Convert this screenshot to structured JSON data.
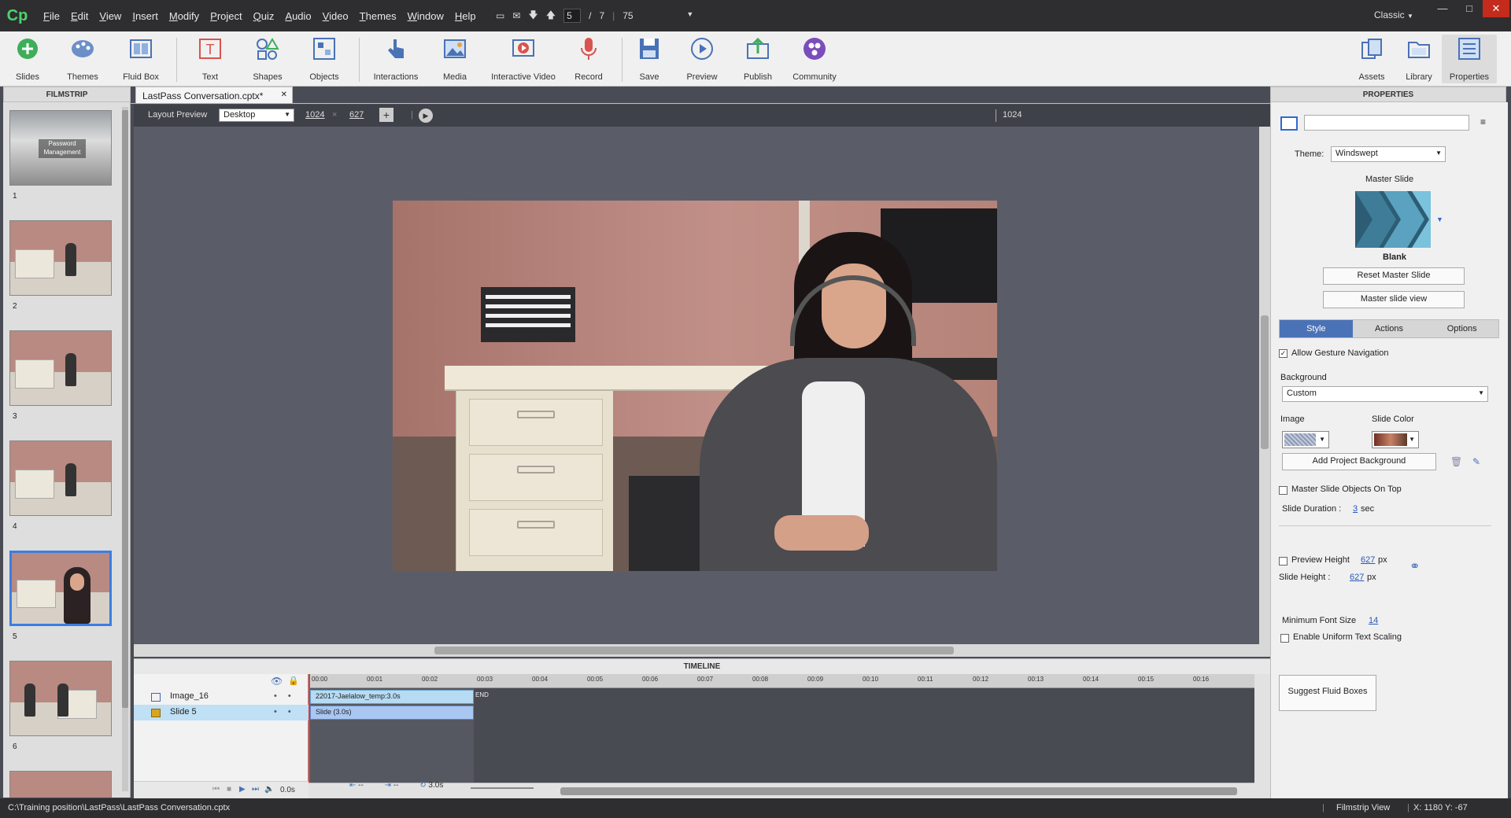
{
  "app": {
    "logo": "Cp",
    "mode": "Classic"
  },
  "menu": [
    "File",
    "Edit",
    "View",
    "Insert",
    "Modify",
    "Project",
    "Quiz",
    "Audio",
    "Video",
    "Themes",
    "Window",
    "Help"
  ],
  "navigation": {
    "current_slide": "5",
    "separator": "/",
    "total_slides": "7",
    "zoom": "75"
  },
  "toolbar": {
    "slides": "Slides",
    "themes": "Themes",
    "fluid_box": "Fluid Box",
    "text": "Text",
    "shapes": "Shapes",
    "objects": "Objects",
    "interactions": "Interactions",
    "media": "Media",
    "interactive_video": "Interactive Video",
    "record": "Record",
    "save": "Save",
    "preview": "Preview",
    "publish": "Publish",
    "community": "Community",
    "assets": "Assets",
    "library": "Library",
    "properties": "Properties"
  },
  "filmstrip": {
    "title": "FILMSTRIP",
    "thumb1_text": "Password Management",
    "numbers": [
      "1",
      "2",
      "3",
      "4",
      "5",
      "6"
    ]
  },
  "document": {
    "tab": "LastPass Conversation.cptx*"
  },
  "layout_preview": {
    "label": "Layout Preview",
    "device": "Desktop",
    "width": "1024",
    "height": "627",
    "ruler_value": "1024"
  },
  "timeline": {
    "title": "TIMELINE",
    "rows": [
      {
        "name": "Image_16"
      },
      {
        "name": "Slide 5"
      }
    ],
    "ruler": [
      "00:00",
      "00:01",
      "00:02",
      "00:03",
      "00:04",
      "00:05",
      "00:06",
      "00:07",
      "00:08",
      "00:09",
      "00:10",
      "00:11",
      "00:12",
      "00:13",
      "00:14",
      "00:15",
      "00:16"
    ],
    "bar_image": "22017-Jaelalow_temp:3.0s",
    "bar_slide": "Slide (3.0s)",
    "end_label": "END",
    "time_current": "0.0s",
    "time_dash1": "--",
    "time_dash2": "--",
    "time_duration": "3.0s"
  },
  "properties": {
    "title": "PROPERTIES",
    "theme_label": "Theme:",
    "theme_value": "Windswept",
    "master_slide_label": "Master Slide",
    "master_name": "Blank",
    "reset_master": "Reset Master Slide",
    "master_view": "Master slide view",
    "tabs": [
      "Style",
      "Actions",
      "Options"
    ],
    "allow_gesture": "Allow Gesture Navigation",
    "background_label": "Background",
    "background_value": "Custom",
    "image_label": "Image",
    "slide_color_label": "Slide Color",
    "add_project_bg": "Add Project Background",
    "master_objects_top": "Master Slide Objects On Top",
    "slide_duration_label": "Slide Duration :",
    "slide_duration_value": "3",
    "slide_duration_unit": "sec",
    "preview_height_label": "Preview Height",
    "preview_height_value": "627",
    "slide_height_label": "Slide Height :",
    "slide_height_value": "627",
    "px": "px",
    "min_font_label": "Minimum Font Size",
    "min_font_value": "14",
    "uniform_scaling": "Enable Uniform Text Scaling",
    "suggest_fluid": "Suggest Fluid Boxes"
  },
  "status": {
    "path": "C:\\Training position\\LastPass\\LastPass Conversation.cptx",
    "view": "Filmstrip View",
    "coords": "X: 1180 Y: -67"
  },
  "colors": {
    "accent": "#4a72b6",
    "menubar": "#2e2e31",
    "stage": "#5a5d68",
    "selection": "#3d7de0"
  }
}
